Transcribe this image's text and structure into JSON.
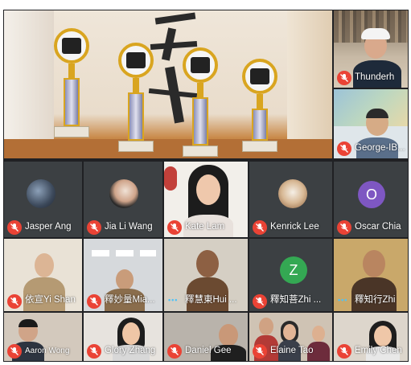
{
  "meeting": {
    "participants": [
      {
        "id": "thunderh",
        "name": "Thunderh",
        "muted": true
      },
      {
        "id": "george",
        "name": "George-IB...",
        "muted": true
      },
      {
        "id": "jasper",
        "name": "Jasper Ang",
        "muted": true
      },
      {
        "id": "jiali",
        "name": "Jia Li Wang",
        "muted": true
      },
      {
        "id": "kate",
        "name": "Kate Lam",
        "muted": true
      },
      {
        "id": "kenrick",
        "name": "Kenrick Lee",
        "muted": true
      },
      {
        "id": "oscar",
        "name": "Oscar Chia",
        "muted": true,
        "avatar_letter": "O"
      },
      {
        "id": "yishan",
        "name": "依宣Yi Shan",
        "muted": true
      },
      {
        "id": "miao",
        "name": "釋妙量Mia...",
        "muted": true
      },
      {
        "id": "huijie",
        "name": "釋慧東Hui ...",
        "muted": false,
        "speaking": true
      },
      {
        "id": "zhi1",
        "name": "釋知菩Zhi ...",
        "muted": true,
        "avatar_letter": "Z"
      },
      {
        "id": "zhi2",
        "name": "釋知行Zhi",
        "muted": false,
        "speaking": true
      },
      {
        "id": "aaron",
        "name": "Aaron Wong",
        "muted": true
      },
      {
        "id": "glory",
        "name": "Glory Zhang",
        "muted": true
      },
      {
        "id": "daniel",
        "name": "Daniel Gee",
        "muted": true
      },
      {
        "id": "elaine",
        "name": "Elaine Tao",
        "muted": true
      },
      {
        "id": "emily",
        "name": "Emily Chen",
        "muted": true
      }
    ]
  },
  "colors": {
    "mute_badge": "#ea4335",
    "speaking_dots": "#4fc3f7",
    "oscar_avatar": "#7e57c2",
    "zhi_avatar": "#34a853",
    "grid_bg": "#202124"
  },
  "icons": {
    "mute": "mic-off-icon",
    "speaking": "audio-dots-icon"
  }
}
